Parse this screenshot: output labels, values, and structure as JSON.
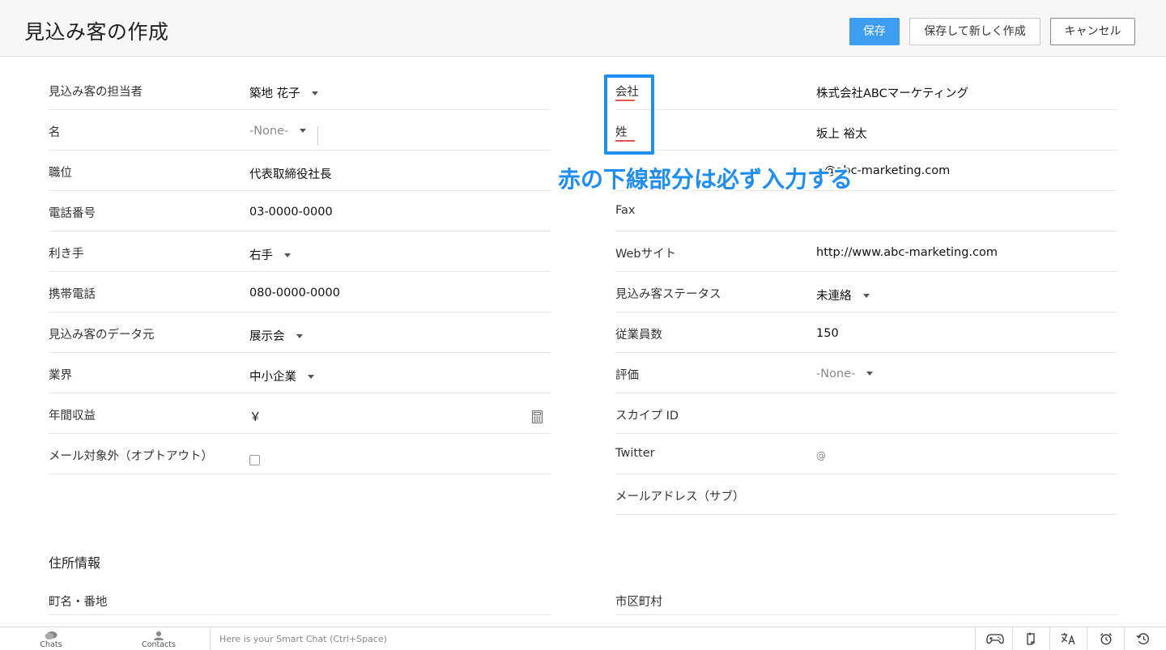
{
  "header": {
    "title": "見込み客の作成",
    "save_label": "保存",
    "save_new_label": "保存して新しく作成",
    "cancel_label": "キャンセル"
  },
  "left_fields": [
    {
      "label": "見込み客の担当者",
      "value": "築地 花子"
    },
    {
      "label": "名",
      "value": "-None-"
    },
    {
      "label": "職位",
      "value": "代表取締役社長"
    },
    {
      "label": "電話番号",
      "value": "03-0000-0000"
    },
    {
      "label": "利き手",
      "value": "右手"
    },
    {
      "label": "携帯電話",
      "value": "080-0000-0000"
    },
    {
      "label": "見込み客のデータ元",
      "value": "展示会"
    },
    {
      "label": "業界",
      "value": "中小企業"
    },
    {
      "label": "年間収益",
      "value": "￥"
    },
    {
      "label": "メール対象外（オプトアウト）",
      "value": ""
    }
  ],
  "right_fields": [
    {
      "label": "会社",
      "value": "株式会社ABCマーケティング"
    },
    {
      "label": "姓",
      "value": "坂上 裕太"
    },
    {
      "label": "",
      "value": "@abc-marketing.com"
    },
    {
      "label": "Fax",
      "value": ""
    },
    {
      "label": "Webサイト",
      "value": "http://www.abc-marketing.com"
    },
    {
      "label": "見込み客ステータス",
      "value": "未連絡"
    },
    {
      "label": "従業員数",
      "value": "150"
    },
    {
      "label": "評価",
      "value": "-None-"
    },
    {
      "label": "スカイプ ID",
      "value": ""
    },
    {
      "label": "Twitter",
      "value": "@"
    },
    {
      "label": "メールアドレス（サブ）",
      "value": ""
    }
  ],
  "address": {
    "section_title": "住所情報",
    "street_label": "町名・番地",
    "city_label": "市区町村"
  },
  "annotation": {
    "text": "赤の下線部分は必ず入力する",
    "color": "#1f8ef1"
  },
  "bottom_bar": {
    "chats_label": "Chats",
    "contacts_label": "Contacts",
    "smart_chat_placeholder": "Here is your Smart Chat (Ctrl+Space)"
  },
  "colors": {
    "primary_button": "#3d9ef0",
    "required_underline": "#e2574c",
    "annotation_blue": "#1f8ef1"
  }
}
